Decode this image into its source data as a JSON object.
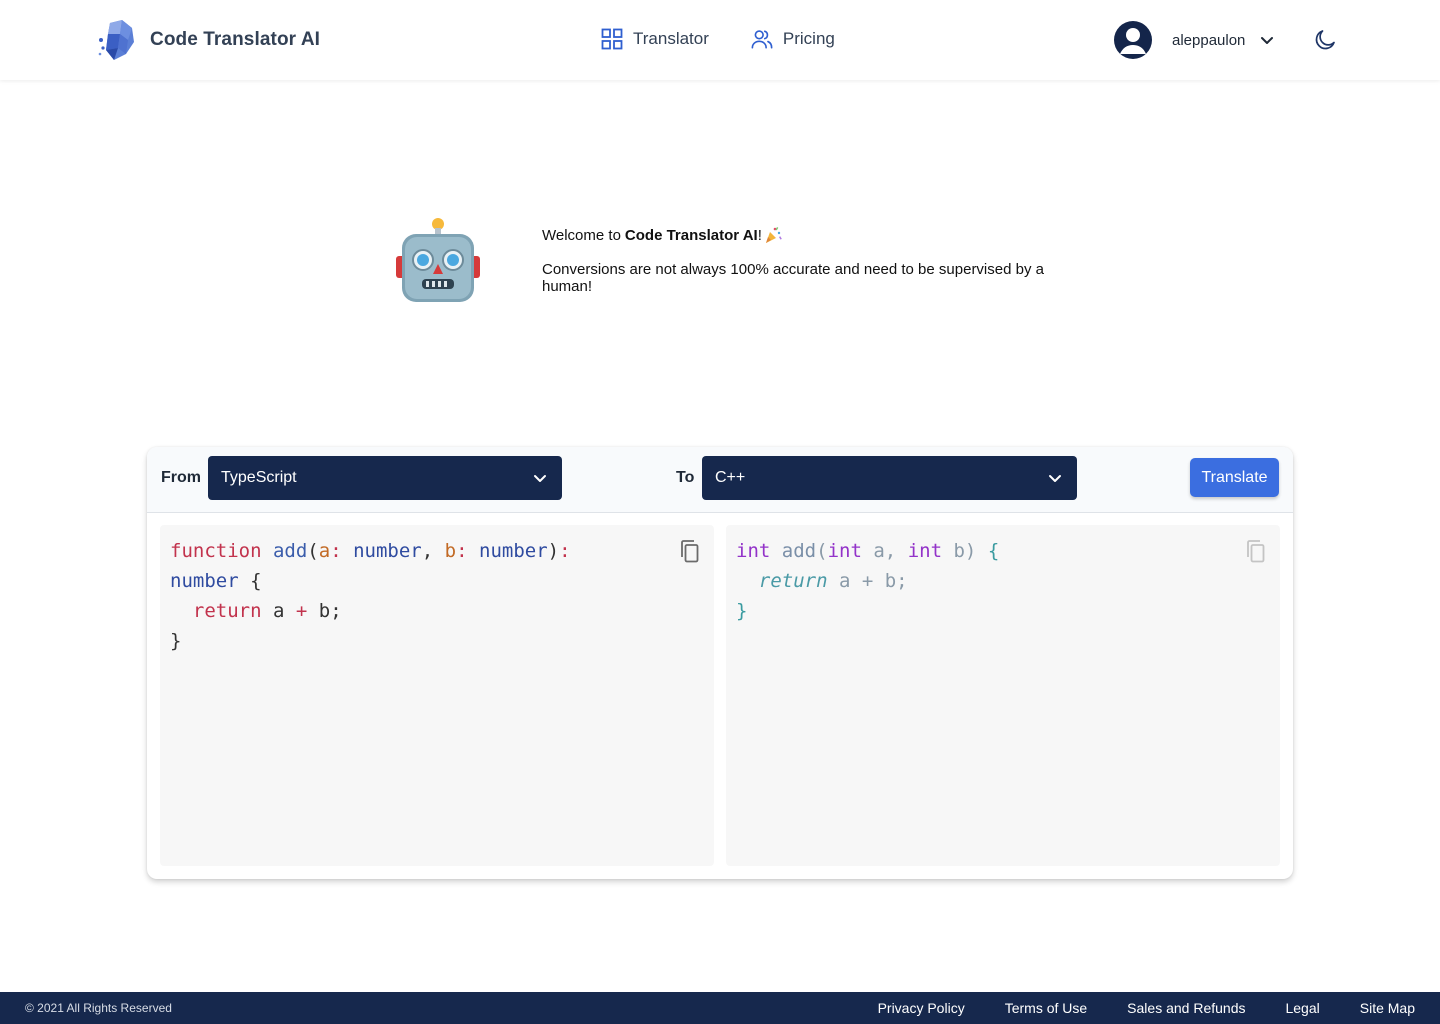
{
  "header": {
    "brand_name": "Code Translator AI",
    "nav": [
      {
        "label": "Translator",
        "icon": "grid-icon"
      },
      {
        "label": "Pricing",
        "icon": "users-icon"
      }
    ],
    "user": {
      "name": "aleppaulon"
    },
    "theme_icon": "moon-icon"
  },
  "welcome": {
    "prefix": "Welcome to",
    "app_name": "Code Translator AI",
    "suffix": "!",
    "disclaimer": "Conversions are not always 100% accurate and need to be supervised by a human!"
  },
  "translator": {
    "from_label": "From",
    "from_value": "TypeScript",
    "to_label": "To",
    "to_value": "C++",
    "translate_label": "Translate",
    "input_code": [
      "function add(a: number, b: number):",
      "number {",
      "  return a + b;",
      "}"
    ],
    "output_code": [
      "int add(int a, int b) {",
      "  return a + b;",
      "}"
    ]
  },
  "colors": {
    "navy": "#16284d",
    "accent": "#3b6ee0"
  },
  "footer": {
    "copyright": "© 2021 All Rights Reserved",
    "links": [
      "Privacy Policy",
      "Terms of Use",
      "Sales and Refunds",
      "Legal",
      "Site Map"
    ]
  }
}
